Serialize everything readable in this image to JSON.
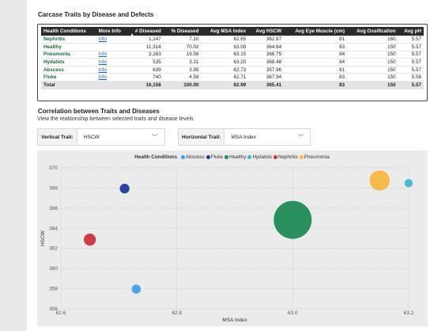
{
  "table_section": {
    "title": "Carcase Traits by Disease and Defects",
    "headers": [
      "Health Conditions",
      "More Info",
      "# Diseased",
      "% Diseased",
      "Avg MSA Index",
      "Avg HSCW",
      "Avg Eye Muscle (cm)",
      "Avg Ossification",
      "Avg pH"
    ],
    "sort_indicator": "▲",
    "rows": [
      {
        "condition": "Nephritis",
        "info": "Info",
        "diseased": "1,147",
        "pct": "7.10",
        "msa": "62.65",
        "hscw": "362.87",
        "eye": "81",
        "oss": "160",
        "ph": "5.57"
      },
      {
        "condition": "Healthy",
        "info": "",
        "diseased": "11,314",
        "pct": "70.02",
        "msa": "63.00",
        "hscw": "364.84",
        "eye": "83",
        "oss": "150",
        "ph": "5.57"
      },
      {
        "condition": "Pneumonia",
        "info": "Info",
        "diseased": "3,163",
        "pct": "19.58",
        "msa": "63.15",
        "hscw": "368.75",
        "eye": "84",
        "oss": "150",
        "ph": "5.57"
      },
      {
        "condition": "Hydatids",
        "info": "Info",
        "diseased": "535",
        "pct": "3.31",
        "msa": "63.20",
        "hscw": "368.48",
        "eye": "84",
        "oss": "150",
        "ph": "5.57"
      },
      {
        "condition": "Abscess",
        "info": "Info",
        "diseased": "639",
        "pct": "3.95",
        "msa": "62.73",
        "hscw": "357.96",
        "eye": "81",
        "oss": "150",
        "ph": "5.57"
      },
      {
        "condition": "Fluke",
        "info": "Info",
        "diseased": "740",
        "pct": "4.58",
        "msa": "62.71",
        "hscw": "367.94",
        "eye": "83",
        "oss": "150",
        "ph": "5.58"
      }
    ],
    "total": {
      "label": "Total",
      "diseased": "16,158",
      "pct": "100.00",
      "msa": "62.99",
      "hscw": "365.41",
      "eye": "83",
      "oss": "150",
      "ph": "5.57"
    }
  },
  "correlation_section": {
    "title": "Correlation between Traits and Diseases",
    "subtitle": "View the realtionship between selected traits and disease levels.",
    "vertical_label": "Vertical Trait:",
    "vertical_value": "HSCW",
    "horizontal_label": "Horizontal Trait:",
    "horizontal_value": "MSA Index",
    "chevron": "﹀"
  },
  "colors": {
    "Abscess": "#3ba0f0",
    "Fluke": "#1f3a9e",
    "Healthy": "#1e8a56",
    "Hydatids": "#3fb8d4",
    "Nephritis": "#d1323b",
    "Pneumonia": "#f7b940"
  },
  "chart_data": {
    "type": "scatter",
    "legend_title": "Health Conditions",
    "legend": [
      "Abscess",
      "Fluke",
      "Healthy",
      "Hydatids",
      "Nephritis",
      "Pneumonia"
    ],
    "xlabel": "MSA Index",
    "ylabel": "HSCW",
    "xlim": [
      62.6,
      63.2
    ],
    "ylim": [
      356,
      370
    ],
    "xticks": [
      62.6,
      62.8,
      63.0,
      63.2
    ],
    "xtick_labels": [
      "62.6",
      "62.8",
      "63.0",
      "63.2"
    ],
    "yticks": [
      356,
      358,
      360,
      362,
      364,
      366,
      368,
      370
    ],
    "grid": true,
    "legend_position": "top",
    "series": [
      {
        "name": "Abscess",
        "x": 62.73,
        "y": 357.96,
        "size": 639
      },
      {
        "name": "Fluke",
        "x": 62.71,
        "y": 367.94,
        "size": 740
      },
      {
        "name": "Healthy",
        "x": 63.0,
        "y": 364.84,
        "size": 11314
      },
      {
        "name": "Hydatids",
        "x": 63.2,
        "y": 368.48,
        "size": 535
      },
      {
        "name": "Nephritis",
        "x": 62.65,
        "y": 362.87,
        "size": 1147
      },
      {
        "name": "Pneumonia",
        "x": 63.15,
        "y": 368.75,
        "size": 3163
      }
    ]
  }
}
